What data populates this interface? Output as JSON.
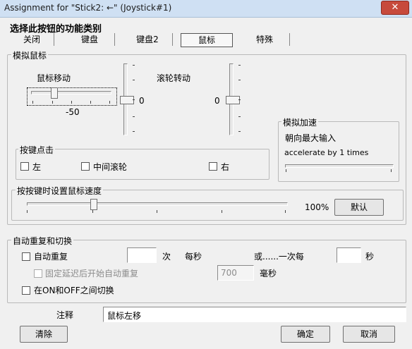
{
  "window": {
    "title": "Assignment for \"Stick2: ←\" (Joystick#1)",
    "close_glyph": "✕"
  },
  "heading": "选择此按钮的功能类别",
  "tabs": [
    {
      "label": "关闭"
    },
    {
      "label": "键盘"
    },
    {
      "label": "键盘2"
    },
    {
      "label": "鼠标"
    },
    {
      "label": "特殊"
    }
  ],
  "mouse_sim": {
    "group_label": "模拟鼠标",
    "move_label": "鼠标移动",
    "move_value": "-50",
    "vertical_move_value": "0",
    "wheel_label": "滚轮转动",
    "wheel_value": "0"
  },
  "click": {
    "group_label": "按键点击",
    "left": "左",
    "middle": "中间滚轮",
    "right": "右"
  },
  "accel": {
    "group_label": "模拟加速",
    "max_label": "朝向最大输入",
    "text": "accelerate by 1 times"
  },
  "speed": {
    "group_label": "按按键时设置鼠标速度",
    "percent": "100%",
    "default_button": "默认"
  },
  "repeat": {
    "group_label": "自动重复和切换",
    "auto_repeat": "自动重复",
    "times_unit": "次",
    "per_second": "每秒",
    "or_once_every": "或......一次每",
    "seconds_unit": "秒",
    "fixed_delay": "固定延迟后开始自动重复",
    "delay_value": "700",
    "ms_unit": "毫秒",
    "toggle": "在ON和OFF之间切换"
  },
  "comment": {
    "label": "注释",
    "value": "鼠标左移"
  },
  "buttons": {
    "clear": "清除",
    "ok": "确定",
    "cancel": "取消"
  }
}
